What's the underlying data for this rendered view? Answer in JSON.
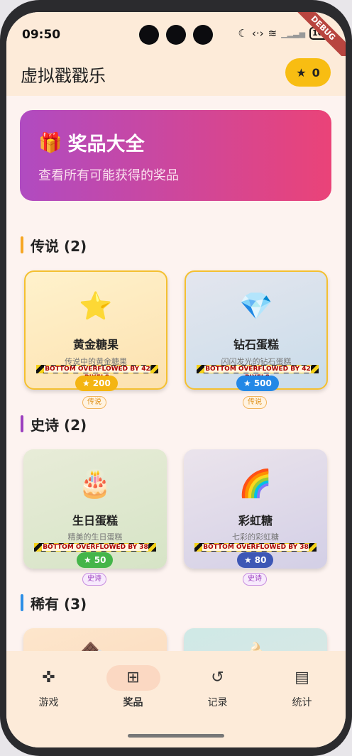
{
  "status": {
    "time": "09:50",
    "battery": "100"
  },
  "debug_banner": "DEBUG",
  "appbar": {
    "title": "虚拟戳戳乐",
    "stars": "0"
  },
  "hero": {
    "emoji": "🎁",
    "title": "奖品大全",
    "subtitle": "查看所有可能获得的奖品"
  },
  "overflow_text_42": "BOTTOM OVERFLOWED BY 42 PIXELS",
  "overflow_text_38": "BOTTOM OVERFLOWED BY 38 PIXELS",
  "sections": {
    "legendary": {
      "label": "传说 (2)",
      "color": "#f6a623"
    },
    "epic": {
      "label": "史诗 (2)",
      "color": "#9c3fbf"
    },
    "rare": {
      "label": "稀有 (3)",
      "color": "#2d8fe6"
    }
  },
  "prizes": {
    "legendary": [
      {
        "emoji": "⭐",
        "name": "黄金糖果",
        "desc": "传说中的黄金糖果",
        "price": "200",
        "tag": "传说"
      },
      {
        "emoji": "💎",
        "name": "钻石蛋糕",
        "desc": "闪闪发光的钻石蛋糕",
        "price": "500",
        "tag": "传说"
      }
    ],
    "epic": [
      {
        "emoji": "🎂",
        "name": "生日蛋糕",
        "desc": "精美的生日蛋糕",
        "price": "50",
        "tag": "史诗"
      },
      {
        "emoji": "🌈",
        "name": "彩虹糖",
        "desc": "七彩的彩虹糖",
        "price": "80",
        "tag": "史诗"
      }
    ],
    "rare": [
      {
        "emoji": "🍫"
      },
      {
        "emoji": "🍦"
      }
    ]
  },
  "nav": [
    {
      "label": "游戏",
      "icon": "gamepad-icon"
    },
    {
      "label": "奖品",
      "icon": "gift-icon"
    },
    {
      "label": "记录",
      "icon": "history-icon"
    },
    {
      "label": "统计",
      "icon": "chart-icon"
    }
  ]
}
